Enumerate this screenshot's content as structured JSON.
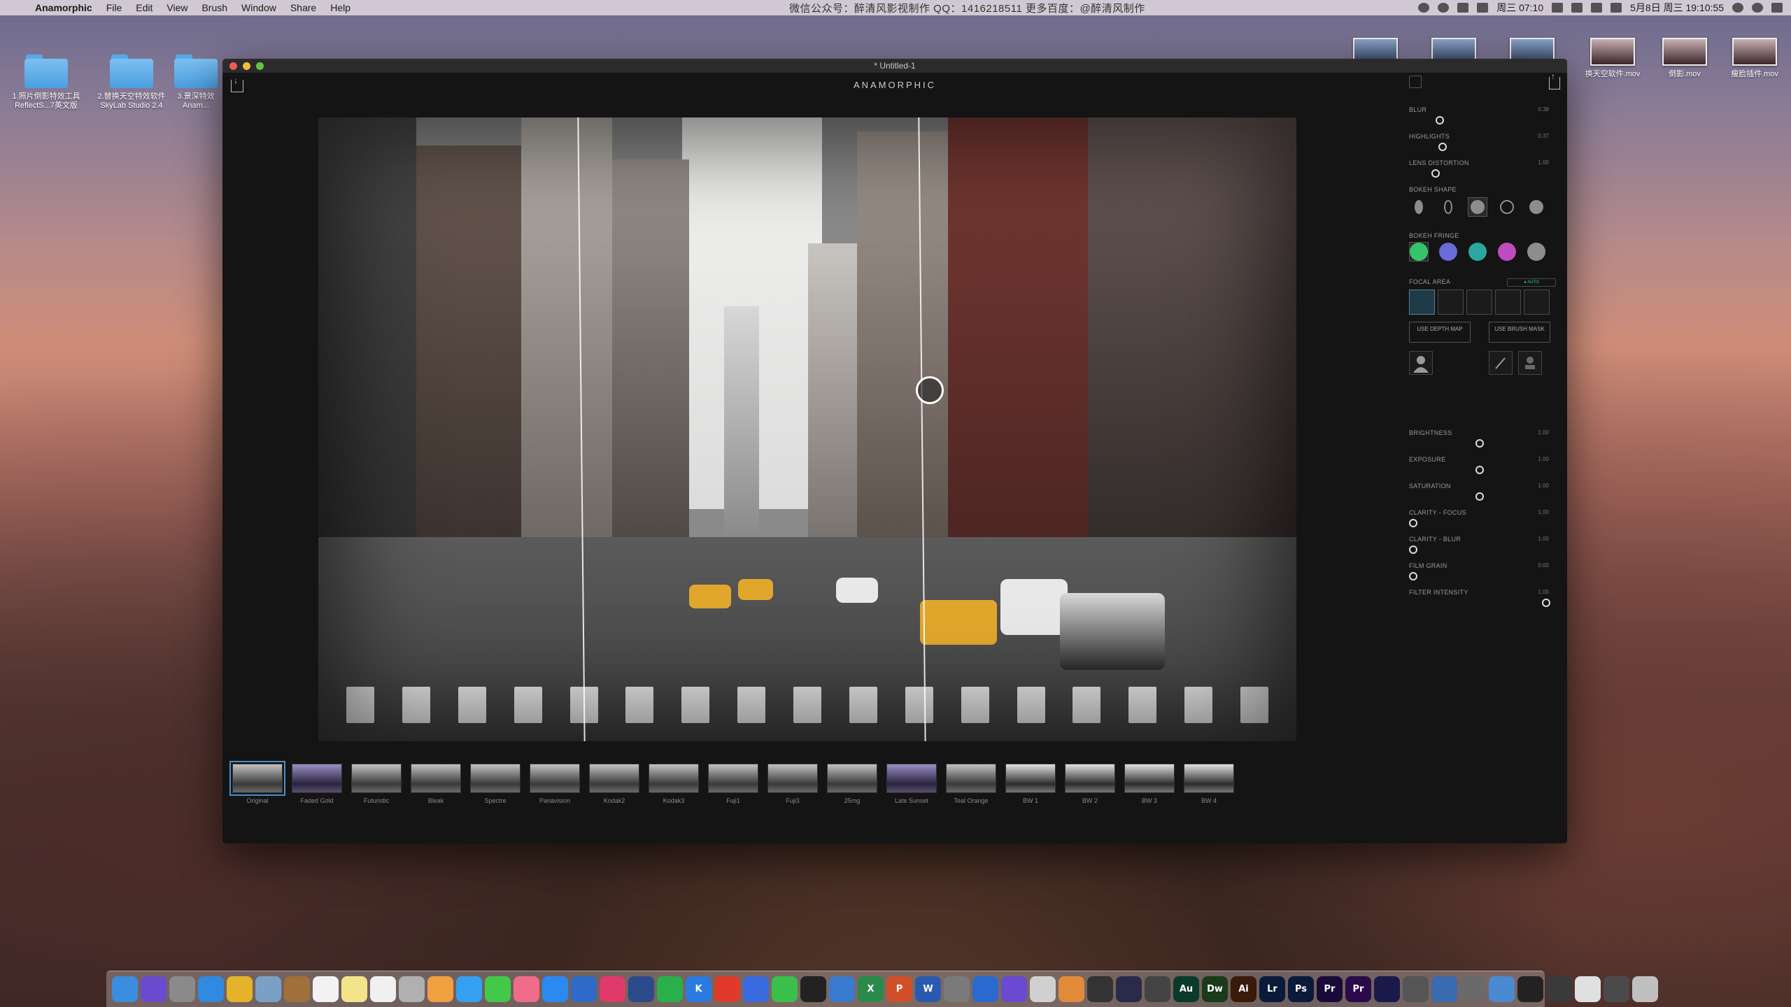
{
  "menubar": {
    "app_name": "Anamorphic",
    "menus": [
      "File",
      "Edit",
      "View",
      "Brush",
      "Window",
      "Share",
      "Help"
    ],
    "center_text": "微信公众号：醉清风影视制作   QQ：1416218511   更多百度：@醉清风制作",
    "clock_time": "周三 07:10",
    "date_time": "5月8日 周三  19:10:55"
  },
  "desktop": {
    "left_items": [
      {
        "label": "1.照片倒影特效工具 ReflectS...7英文版"
      },
      {
        "label": "2.替换天空特效软件 SkyLab Studio 2.4"
      },
      {
        "label": "3.景深特效 Anam..."
      }
    ],
    "right_items": [
      {
        "label": "换天空软件.mov"
      },
      {
        "label": "倒影.mov"
      },
      {
        "label": "瘦脸插件.mov"
      }
    ]
  },
  "window": {
    "title": "* Untitled-1",
    "logo": "ANAMORPHIC"
  },
  "filters": [
    {
      "label": "Original",
      "style": "normal",
      "active": true
    },
    {
      "label": "Faded Gold",
      "style": "tinted"
    },
    {
      "label": "Futuristic",
      "style": "normal"
    },
    {
      "label": "Bleak",
      "style": "normal"
    },
    {
      "label": "Spectre",
      "style": "normal"
    },
    {
      "label": "Panavision",
      "style": "normal"
    },
    {
      "label": "Kodak2",
      "style": "normal"
    },
    {
      "label": "Kodak3",
      "style": "normal"
    },
    {
      "label": "Fuji1",
      "style": "normal"
    },
    {
      "label": "Fuji3",
      "style": "normal"
    },
    {
      "label": "25mg",
      "style": "normal"
    },
    {
      "label": "Late Sunset",
      "style": "tinted"
    },
    {
      "label": "Teal Orange",
      "style": "normal"
    },
    {
      "label": "BW 1",
      "style": "bw"
    },
    {
      "label": "BW 2",
      "style": "bw"
    },
    {
      "label": "BW 3",
      "style": "bw"
    },
    {
      "label": "BW 4",
      "style": "bw"
    }
  ],
  "panel": {
    "blur": {
      "label": "BLUR",
      "value": "0.38",
      "level": 0.2
    },
    "highlights": {
      "label": "HIGHLIGHTS",
      "value": "0.37",
      "level": 0.22
    },
    "lens_distortion": {
      "label": "LENS DISTORTION",
      "value": "1.00",
      "level": 0.17
    },
    "bokeh_shape": {
      "label": "BOKEH SHAPE"
    },
    "bokeh_fringe": {
      "label": "BOKEH FRINGE",
      "colors": [
        "#34c46a",
        "#6a6ad8",
        "#2ba7a0",
        "#c04ac0",
        "#8d8d8d"
      ]
    },
    "focal_area": {
      "label": "FOCAL AREA",
      "toggle": "● AUTO"
    },
    "use_depth_map": "USE DEPTH MAP",
    "use_brush_mask": "USE BRUSH MASK",
    "brightness": {
      "label": "BRIGHTNESS",
      "value": "1.00",
      "level": 0.5
    },
    "exposure": {
      "label": "EXPOSURE",
      "value": "1.00",
      "level": 0.5
    },
    "saturation": {
      "label": "SATURATION",
      "value": "1.00",
      "level": 0.5
    },
    "clarity_focus": {
      "label": "CLARITY - FOCUS",
      "value": "1.00",
      "level": 0.0
    },
    "clarity_blur": {
      "label": "CLARITY - BLUR",
      "value": "1.00",
      "level": 0.0
    },
    "film_grain": {
      "label": "FILM GRAIN",
      "value": "0.00",
      "level": 0.0
    },
    "filter_intensity": {
      "label": "FILTER INTENSITY",
      "value": "1.00",
      "level": 1.0
    }
  },
  "dock": {
    "apps": [
      {
        "name": "finder",
        "color": "#3b8de0",
        "glyph": ""
      },
      {
        "name": "siri",
        "color": "#6a4bd0",
        "glyph": ""
      },
      {
        "name": "launchpad",
        "color": "#8a8a8a",
        "glyph": ""
      },
      {
        "name": "safari",
        "color": "#2f8ae0",
        "glyph": ""
      },
      {
        "name": "chrome",
        "color": "#e4b32a",
        "glyph": ""
      },
      {
        "name": "preview",
        "color": "#7aa0c8",
        "glyph": ""
      },
      {
        "name": "notes-brown",
        "color": "#a0703a",
        "glyph": ""
      },
      {
        "name": "calendar",
        "color": "#f2f2f2",
        "glyph": ""
      },
      {
        "name": "notes",
        "color": "#f3e48a",
        "glyph": ""
      },
      {
        "name": "reminders",
        "color": "#f0f0f0",
        "glyph": ""
      },
      {
        "name": "photo-booth",
        "color": "#b0b0b0",
        "glyph": ""
      },
      {
        "name": "photos",
        "color": "#f0a040",
        "glyph": ""
      },
      {
        "name": "messages-blue",
        "color": "#36a0f0",
        "glyph": ""
      },
      {
        "name": "messages",
        "color": "#44c84a",
        "glyph": ""
      },
      {
        "name": "music",
        "color": "#f06a8a",
        "glyph": ""
      },
      {
        "name": "app-store",
        "color": "#2a8af0",
        "glyph": ""
      },
      {
        "name": "facetime",
        "color": "#2f6ac8",
        "glyph": ""
      },
      {
        "name": "folder-pink",
        "color": "#e03a6a",
        "glyph": ""
      },
      {
        "name": "quicktime",
        "color": "#2a4a8a",
        "glyph": ""
      },
      {
        "name": "spotify",
        "color": "#2ab04a",
        "glyph": ""
      },
      {
        "name": "kuaibo",
        "color": "#2a7ae0",
        "glyph": "K"
      },
      {
        "name": "weibo",
        "color": "#e03a2a",
        "glyph": ""
      },
      {
        "name": "baidu",
        "color": "#3a6ae0",
        "glyph": ""
      },
      {
        "name": "wechat",
        "color": "#3ac04a",
        "glyph": ""
      },
      {
        "name": "qq",
        "color": "#222222",
        "glyph": ""
      },
      {
        "name": "keynote",
        "color": "#3a7ad0",
        "glyph": ""
      },
      {
        "name": "excel",
        "color": "#2a8a4a",
        "glyph": "X"
      },
      {
        "name": "powerpoint",
        "color": "#d0502a",
        "glyph": "P"
      },
      {
        "name": "word",
        "color": "#2a5ab0",
        "glyph": "W"
      },
      {
        "name": "system-prefs",
        "color": "#7a7a7a",
        "glyph": ""
      },
      {
        "name": "xcode",
        "color": "#2a6ad0",
        "glyph": ""
      },
      {
        "name": "imovie",
        "color": "#6a4ad0",
        "glyph": ""
      },
      {
        "name": "mail",
        "color": "#d0d0d0",
        "glyph": ""
      },
      {
        "name": "pages",
        "color": "#e08a3a",
        "glyph": ""
      },
      {
        "name": "final-cut",
        "color": "#333333",
        "glyph": ""
      },
      {
        "name": "motion",
        "color": "#2a2a4a",
        "glyph": ""
      },
      {
        "name": "davinci",
        "color": "#444444",
        "glyph": ""
      },
      {
        "name": "audition",
        "color": "#0a3a2a",
        "glyph": "Au"
      },
      {
        "name": "dreamweaver",
        "color": "#1a3a1a",
        "glyph": "Dw"
      },
      {
        "name": "illustrator",
        "color": "#3a1a0a",
        "glyph": "Ai"
      },
      {
        "name": "lightroom",
        "color": "#0a1a3a",
        "glyph": "Lr"
      },
      {
        "name": "photoshop",
        "color": "#0a1a3a",
        "glyph": "Ps"
      },
      {
        "name": "premiere",
        "color": "#1a0a3a",
        "glyph": "Pr"
      },
      {
        "name": "premiere-2",
        "color": "#2a0a4a",
        "glyph": "Pr"
      },
      {
        "name": "after-effects",
        "color": "#1a1a4a",
        "glyph": ""
      },
      {
        "name": "app-gray",
        "color": "#555555",
        "glyph": ""
      },
      {
        "name": "browser-1",
        "color": "#3a6ab0",
        "glyph": ""
      },
      {
        "name": "browser-2",
        "color": "#6a6a6a",
        "glyph": ""
      },
      {
        "name": "browser-3",
        "color": "#4a8ad0",
        "glyph": ""
      },
      {
        "name": "camera",
        "color": "#222222",
        "glyph": ""
      },
      {
        "name": "screen-1",
        "color": "#3a3a3a",
        "glyph": ""
      },
      {
        "name": "screen-2",
        "color": "#e0e0e0",
        "glyph": ""
      },
      {
        "name": "screen-3",
        "color": "#4a4a4a",
        "glyph": ""
      },
      {
        "name": "trash",
        "color": "#c0c0c0",
        "glyph": ""
      }
    ]
  }
}
